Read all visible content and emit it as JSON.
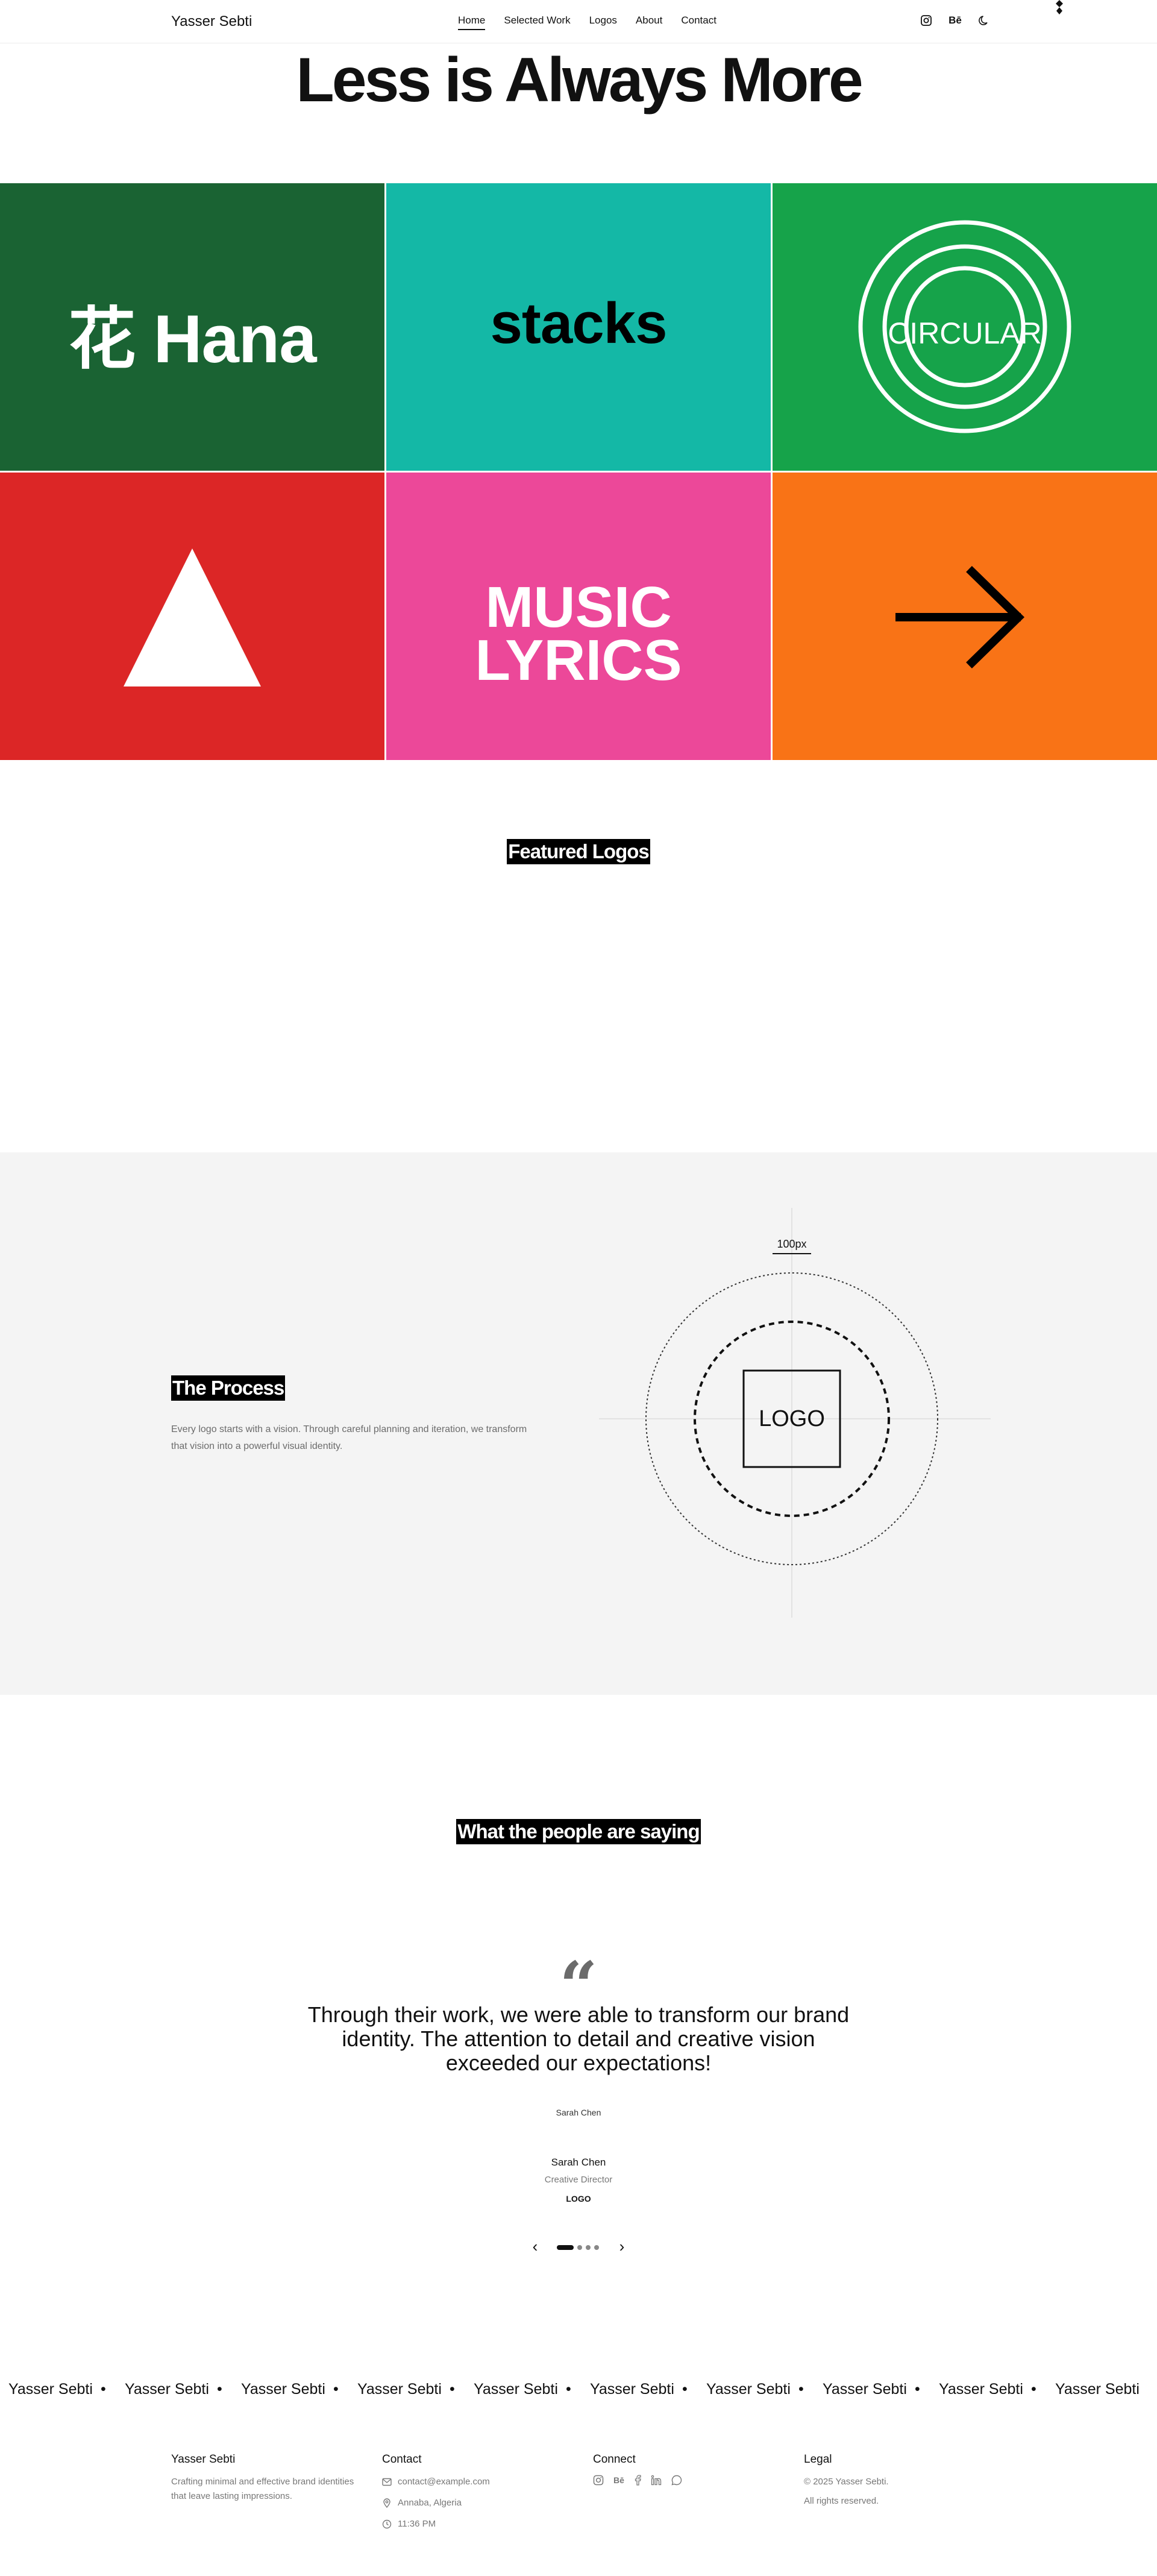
{
  "header": {
    "brand": "Yasser Sebti",
    "nav": [
      "Home",
      "Selected Work",
      "Logos",
      "About",
      "Contact"
    ],
    "icons": [
      "instagram-icon",
      "behance-icon",
      "moon-icon"
    ],
    "behance_label": "Bē"
  },
  "hero": {
    "title": "Less is Always More"
  },
  "tiles": [
    {
      "text": "花 Hana",
      "bg": "#1a6333",
      "fg": "#ffffff"
    },
    {
      "text": "stacks",
      "bg": "#14b8a6",
      "fg": "#000000"
    },
    {
      "text": "CIRCULAR",
      "bg": "#16a34a",
      "fg": "#ffffff"
    },
    {
      "text": "",
      "bg": "#dc2626",
      "fg": "#ffffff"
    },
    {
      "text": "MUSIC LYRICS",
      "line1": "MUSIC",
      "line2": "LYRICS",
      "bg": "#ec4899",
      "fg": "#ffffff"
    },
    {
      "text": "",
      "bg": "#f97316",
      "fg": "#000000"
    }
  ],
  "featured": {
    "title": "Featured Logos"
  },
  "process": {
    "title": "The Process",
    "description": "Every logo starts with a vision. Through careful planning and iteration, we transform that vision into a powerful visual identity.",
    "diagram": {
      "dimension_label": "100px",
      "logo_label": "LOGO"
    },
    "bg": "#f4f4f4"
  },
  "testimonials": {
    "title": "What the people are saying",
    "quote_mark": "“",
    "quote": "Through their work, we were able to transform our brand identity. The attention to detail and creative vision exceeded our expectations!",
    "avatar_alt": "Sarah Chen",
    "name": "Sarah Chen",
    "role": "Creative Director",
    "company": "LOGO",
    "prev": "‹",
    "next": "›"
  },
  "marquee": {
    "items": [
      "Yasser Sebti",
      "Yasser Sebti",
      "Yasser Sebti",
      "Yasser Sebti",
      "Yasser Sebti",
      "Yasser Sebti",
      "Yasser Sebti",
      "Yasser Sebti",
      "Yasser Sebti",
      "Yasser Sebti",
      "Yasser Sebti"
    ],
    "separator": "•"
  },
  "footer": {
    "brand": {
      "title": "Yasser Sebti",
      "text": "Crafting minimal and effective brand identities that leave lasting impressions."
    },
    "contact": {
      "title": "Contact",
      "email": "contact@example.com",
      "location": "Annaba, Algeria",
      "time": "11:36 PM"
    },
    "connect": {
      "title": "Connect",
      "icons": [
        "instagram-icon",
        "behance-icon",
        "facebook-icon",
        "linkedin-icon",
        "whatsapp-icon"
      ]
    },
    "legal": {
      "title": "Legal",
      "copyright": "© 2025 Yasser Sebti.",
      "rights": "All rights reserved."
    }
  }
}
